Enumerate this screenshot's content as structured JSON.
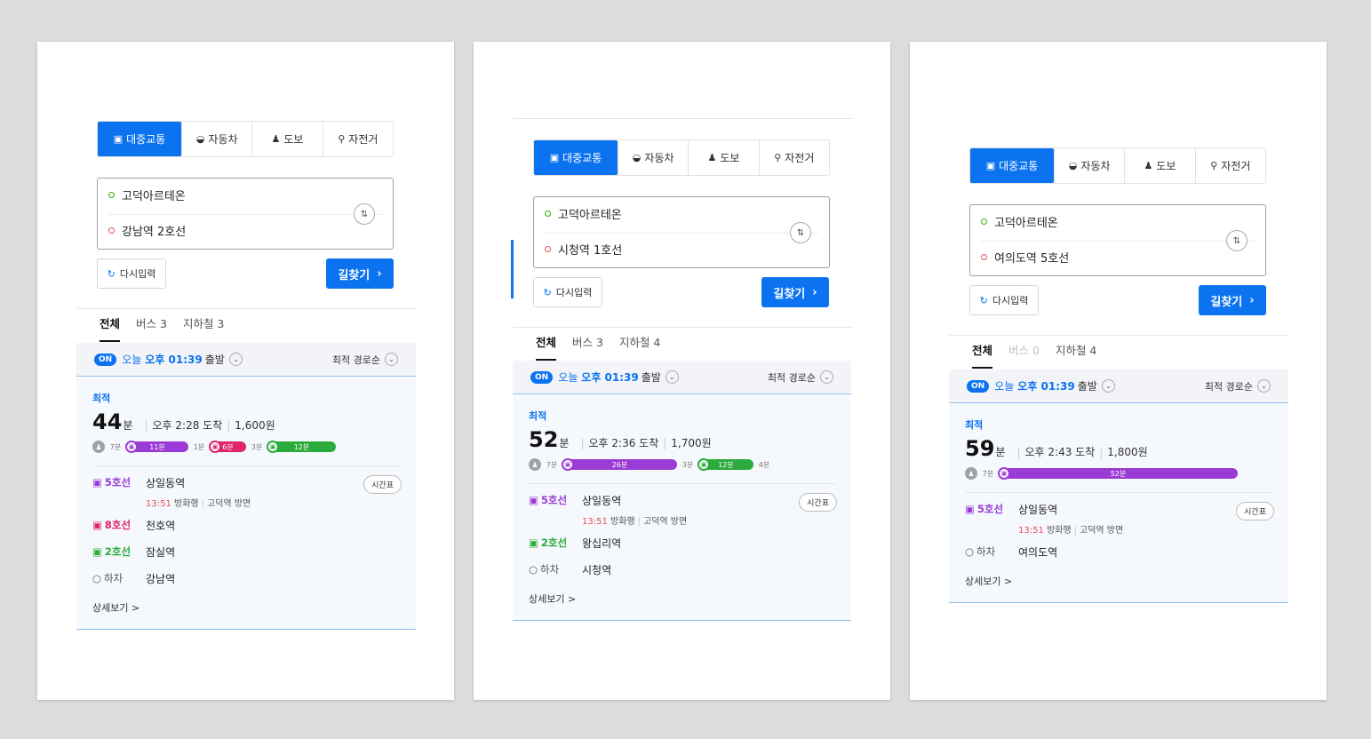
{
  "cards": [
    {
      "modes": [
        {
          "label": "대중교통",
          "icon": "bus-icon"
        },
        {
          "label": "자동차",
          "icon": "car-icon"
        },
        {
          "label": "도보",
          "icon": "walk-icon"
        },
        {
          "label": "자전거",
          "icon": "bike-icon"
        }
      ],
      "origin": "고덕아르테온",
      "destination": "강남역 2호선",
      "reset_label": "다시입력",
      "search_label": "길찾기",
      "tabs": [
        "전체",
        "버스 3",
        "지하철 3"
      ],
      "depart_on": "ON",
      "depart_prefix": "오늘",
      "depart_time": "오후 01:39",
      "depart_suffix": "출발",
      "sort_label": "최적 경로순",
      "best_label": "최적",
      "minutes": "44",
      "minute_unit": "분",
      "arrival": "오후 2:28 도착",
      "fare": "1,600원",
      "segments": [
        {
          "type": "walk",
          "label": "7분"
        },
        {
          "type": "line",
          "label": "11분",
          "color": "#9b3bd6",
          "share": 0.27
        },
        {
          "type": "walk",
          "label": "1분"
        },
        {
          "type": "line",
          "label": "6분",
          "color": "#e0246a",
          "share": 0.16
        },
        {
          "type": "walk",
          "label": "3분"
        },
        {
          "type": "line",
          "label": "12분",
          "color": "#2bab3c",
          "share": 0.3
        }
      ],
      "steps": [
        {
          "line": "5호선",
          "color": "#9b3bd6",
          "station": "상일동역",
          "sub_time": "13:51",
          "sub_dir": "방화행",
          "sub_to": "고덕역 방면",
          "timetable": "시간표"
        },
        {
          "line": "8호선",
          "color": "#e0246a",
          "station": "천호역"
        },
        {
          "line": "2호선",
          "color": "#2bab3c",
          "station": "잠실역"
        },
        {
          "line": "하차",
          "color": "#555555",
          "station": "강남역",
          "alight": true
        }
      ],
      "detail_label": "상세보기 >"
    },
    {
      "modes": [
        {
          "label": "대중교통",
          "icon": "bus-icon"
        },
        {
          "label": "자동차",
          "icon": "car-icon"
        },
        {
          "label": "도보",
          "icon": "walk-icon"
        },
        {
          "label": "자전거",
          "icon": "bike-icon"
        }
      ],
      "origin": "고덕아르테온",
      "destination": "시청역 1호선",
      "reset_label": "다시입력",
      "search_label": "길찾기",
      "tabs": [
        "전체",
        "버스 3",
        "지하철 4"
      ],
      "depart_on": "ON",
      "depart_prefix": "오늘",
      "depart_time": "오후 01:39",
      "depart_suffix": "출발",
      "sort_label": "최적 경로순",
      "best_label": "최적",
      "minutes": "52",
      "minute_unit": "분",
      "arrival": "오후 2:36 도착",
      "fare": "1,700원",
      "segments": [
        {
          "type": "walk",
          "label": "7분"
        },
        {
          "type": "line",
          "label": "26분",
          "color": "#9b3bd6",
          "share": 0.5
        },
        {
          "type": "walk",
          "label": "3분"
        },
        {
          "type": "line",
          "label": "12분",
          "color": "#2bab3c",
          "share": 0.24
        },
        {
          "type": "end",
          "label": "4분"
        }
      ],
      "steps": [
        {
          "line": "5호선",
          "color": "#9b3bd6",
          "station": "상일동역",
          "sub_time": "13:51",
          "sub_dir": "방화행",
          "sub_to": "고덕역 방면",
          "timetable": "시간표"
        },
        {
          "line": "2호선",
          "color": "#2bab3c",
          "station": "왕십리역"
        },
        {
          "line": "하차",
          "color": "#555555",
          "station": "시청역",
          "alight": true
        }
      ],
      "detail_label": "상세보기 >"
    },
    {
      "modes": [
        {
          "label": "대중교통",
          "icon": "bus-icon"
        },
        {
          "label": "자동차",
          "icon": "car-icon"
        },
        {
          "label": "도보",
          "icon": "walk-icon"
        },
        {
          "label": "자전거",
          "icon": "bike-icon"
        }
      ],
      "origin": "고덕아르테온",
      "destination": "여의도역 5호선",
      "reset_label": "다시입력",
      "search_label": "길찾기",
      "tabs": [
        "전체",
        "버스 0",
        "지하철 4"
      ],
      "disabled_tab": 1,
      "depart_on": "ON",
      "depart_prefix": "오늘",
      "depart_time": "오후 01:39",
      "depart_suffix": "출발",
      "sort_label": "최적 경로순",
      "best_label": "최적",
      "minutes": "59",
      "minute_unit": "분",
      "arrival": "오후 2:43 도착",
      "fare": "1,800원",
      "segments": [
        {
          "type": "walk",
          "label": "7분"
        },
        {
          "type": "line",
          "label": "52분",
          "color": "#9b3bd6",
          "share": 0.88
        }
      ],
      "steps": [
        {
          "line": "5호선",
          "color": "#9b3bd6",
          "station": "상일동역",
          "sub_time": "13:51",
          "sub_dir": "방화행",
          "sub_to": "고덕역 방면",
          "timetable": "시간표"
        },
        {
          "line": "하차",
          "color": "#555555",
          "station": "여의도역",
          "alight": true
        }
      ],
      "detail_label": "상세보기 >"
    }
  ]
}
